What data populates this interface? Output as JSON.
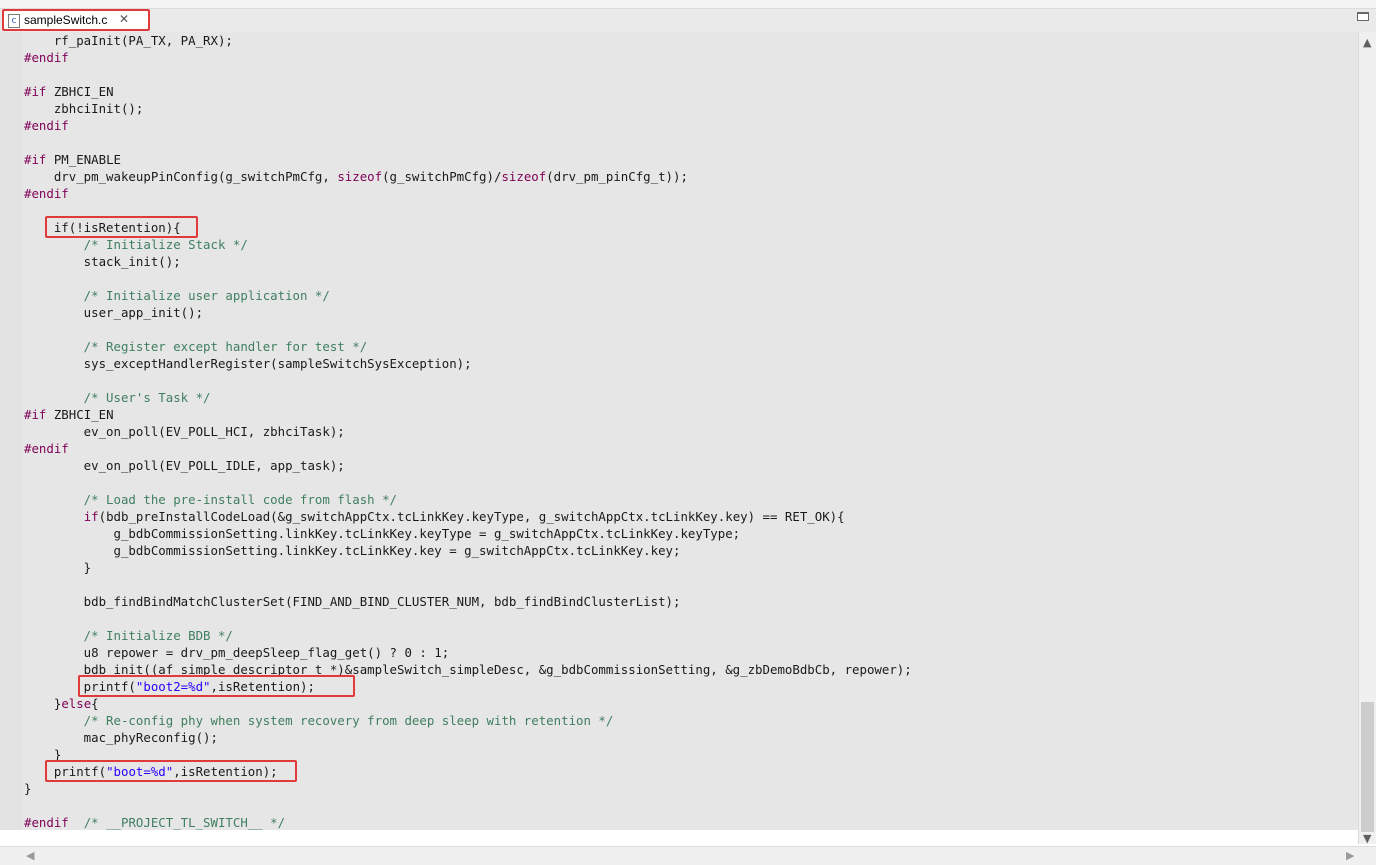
{
  "tab": {
    "label": "sampleSwitch.c",
    "file_icon": "c-file-icon",
    "close_icon": "close-icon"
  },
  "editor": {
    "lines": [
      [
        {
          "t": "    rf_paInit(PA_TX, PA_RX);"
        }
      ],
      [
        {
          "t": "#endif",
          "c": "kw"
        }
      ],
      [],
      [
        {
          "t": "#if",
          "c": "kw"
        },
        {
          "t": " ZBHCI_EN"
        }
      ],
      [
        {
          "t": "    zbhciInit();"
        }
      ],
      [
        {
          "t": "#endif",
          "c": "kw"
        }
      ],
      [],
      [
        {
          "t": "#if",
          "c": "kw"
        },
        {
          "t": " PM_ENABLE"
        }
      ],
      [
        {
          "t": "    drv_pm_wakeupPinConfig(g_switchPmCfg, "
        },
        {
          "t": "sizeof",
          "c": "kw"
        },
        {
          "t": "(g_switchPmCfg)/"
        },
        {
          "t": "sizeof",
          "c": "kw"
        },
        {
          "t": "(drv_pm_pinCfg_t));"
        }
      ],
      [
        {
          "t": "#endif",
          "c": "kw"
        }
      ],
      [],
      [
        {
          "t": "    if(!isRetention){"
        }
      ],
      [
        {
          "t": "        /* Initialize Stack */",
          "c": "cm"
        }
      ],
      [
        {
          "t": "        stack_init();"
        }
      ],
      [],
      [
        {
          "t": "        /* Initialize user application */",
          "c": "cm"
        }
      ],
      [
        {
          "t": "        user_app_init();"
        }
      ],
      [],
      [
        {
          "t": "        /* Register except handler for test */",
          "c": "cm"
        }
      ],
      [
        {
          "t": "        sys_exceptHandlerRegister(sampleSwitchSysException);"
        }
      ],
      [],
      [
        {
          "t": "        /* User's Task */",
          "c": "cm"
        }
      ],
      [
        {
          "t": "#if",
          "c": "kw"
        },
        {
          "t": " ZBHCI_EN"
        }
      ],
      [
        {
          "t": "        ev_on_poll(EV_POLL_HCI, zbhciTask);"
        }
      ],
      [
        {
          "t": "#endif",
          "c": "kw"
        }
      ],
      [
        {
          "t": "        ev_on_poll(EV_POLL_IDLE, app_task);"
        }
      ],
      [],
      [
        {
          "t": "        /* Load the pre-install code from flash */",
          "c": "cm"
        }
      ],
      [
        {
          "t": "        "
        },
        {
          "t": "if",
          "c": "kw"
        },
        {
          "t": "(bdb_preInstallCodeLoad(&g_switchAppCtx.tcLinkKey.keyType, g_switchAppCtx.tcLinkKey.key) == RET_OK){"
        }
      ],
      [
        {
          "t": "            g_bdbCommissionSetting.linkKey.tcLinkKey.keyType = g_switchAppCtx.tcLinkKey.keyType;"
        }
      ],
      [
        {
          "t": "            g_bdbCommissionSetting.linkKey.tcLinkKey.key = g_switchAppCtx.tcLinkKey.key;"
        }
      ],
      [
        {
          "t": "        }"
        }
      ],
      [],
      [
        {
          "t": "        bdb_findBindMatchClusterSet(FIND_AND_BIND_CLUSTER_NUM, bdb_findBindClusterList);"
        }
      ],
      [],
      [
        {
          "t": "        /* Initialize BDB */",
          "c": "cm"
        }
      ],
      [
        {
          "t": "        u8 repower = drv_pm_deepSleep_flag_get() ? 0 : 1;"
        }
      ],
      [
        {
          "t": "        bdb_init((af_simple_descriptor_t *)&sampleSwitch_simpleDesc, &g_bdbCommissionSetting, &g_zbDemoBdbCb, repower);"
        }
      ],
      [
        {
          "t": "        printf("
        },
        {
          "t": "\"boot2=%d\"",
          "c": "st"
        },
        {
          "t": ",isRetention);"
        }
      ],
      [
        {
          "t": "    }"
        },
        {
          "t": "else",
          "c": "kw"
        },
        {
          "t": "{"
        }
      ],
      [
        {
          "t": "        /* Re-config phy when system recovery from deep sleep with retention */",
          "c": "cm"
        }
      ],
      [
        {
          "t": "        mac_phyReconfig();"
        }
      ],
      [
        {
          "t": "    }"
        }
      ],
      [
        {
          "t": "    printf("
        },
        {
          "t": "\"boot=%d\"",
          "c": "st"
        },
        {
          "t": ",isRetention);"
        }
      ],
      [
        {
          "t": "}"
        }
      ],
      [],
      [
        {
          "t": "#endif",
          "c": "kw"
        },
        {
          "t": "  "
        },
        {
          "t": "/* __PROJECT_TL_SWITCH__ */",
          "c": "cm"
        }
      ]
    ]
  },
  "scrollbars": {
    "up_arrow": "▲",
    "down_arrow": "▼",
    "left_arrow": "◀",
    "right_arrow": "▶"
  }
}
